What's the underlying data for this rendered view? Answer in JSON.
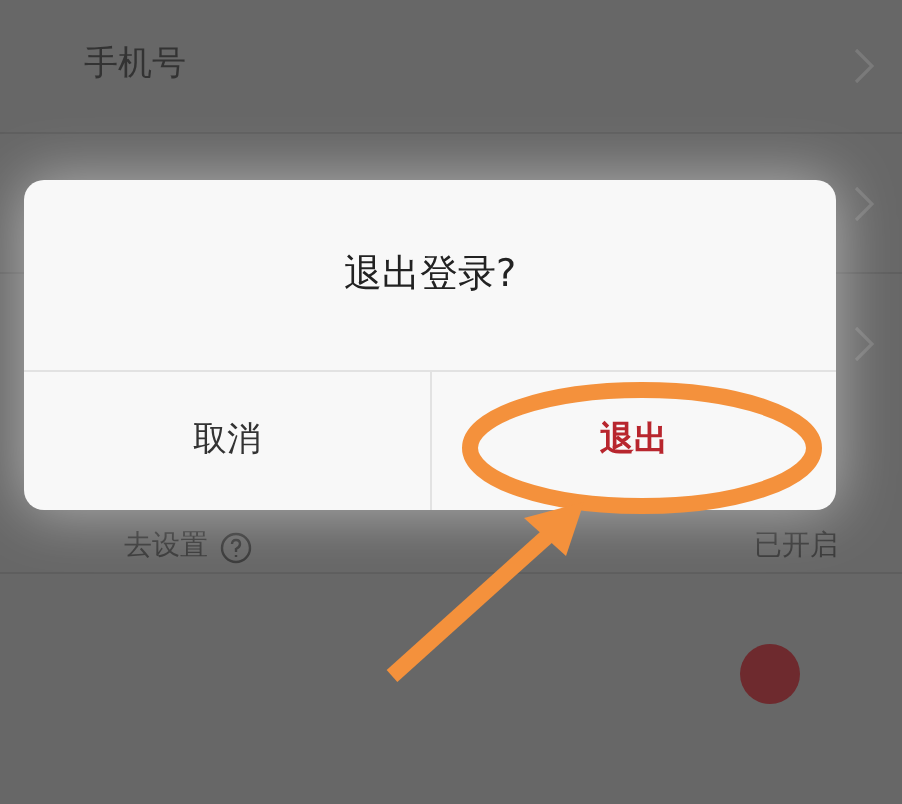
{
  "settings": {
    "phone_label": "手机号",
    "setting_label": "去设置",
    "setting_value": "已开启"
  },
  "dialog": {
    "title": "退出登录?",
    "buttons": [
      {
        "label": "取消",
        "kind": "cancel"
      },
      {
        "label": "退出",
        "kind": "confirm"
      }
    ]
  }
}
